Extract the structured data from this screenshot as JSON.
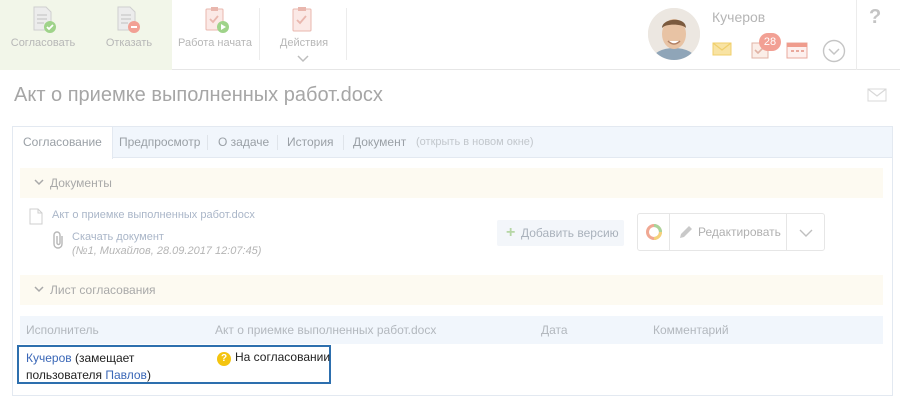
{
  "toolbar": {
    "approve_label": "Согласовать",
    "reject_label": "Отказать",
    "work_started_label": "Работа начата",
    "actions_label": "Действия"
  },
  "user": {
    "name": "Кучеров",
    "tasks_badge": "28"
  },
  "page": {
    "title": "Акт о приемке выполненных работ.docx"
  },
  "tabs": [
    {
      "label": "Согласование",
      "active": true
    },
    {
      "label": "Предпросмотр",
      "active": false
    },
    {
      "label": "О задаче",
      "active": false
    },
    {
      "label": "История",
      "active": false
    },
    {
      "label": "Документ",
      "active": false
    }
  ],
  "tab_open_new": "(открыть в новом окне)",
  "documents": {
    "section_title": "Документы",
    "file_name": "Акт о приемке выполненных работ.docx",
    "download_label": "Скачать документ",
    "meta": "(№1, Михайлов, 28.09.2017 12:07:45)",
    "add_version_label": "Добавить версию",
    "edit_label": "Редактировать"
  },
  "approval": {
    "section_title": "Лист согласования",
    "columns": [
      "Исполнитель",
      "Акт о приемке выполненных работ.docx",
      "Дата",
      "Комментарий"
    ],
    "row": {
      "performer": "Кучеров",
      "substitutes_prefix": "(замещает",
      "substitutes_text": "пользователя",
      "substitutes_user": "Павлов",
      "substitutes_suffix": ")",
      "status": "На согласовании",
      "status_icon": "?"
    }
  },
  "colors": {
    "accent_link": "#3a67b7",
    "highlight_border": "#2d6fae",
    "status_pending": "#f4c40f",
    "badge": "#f2a094"
  }
}
